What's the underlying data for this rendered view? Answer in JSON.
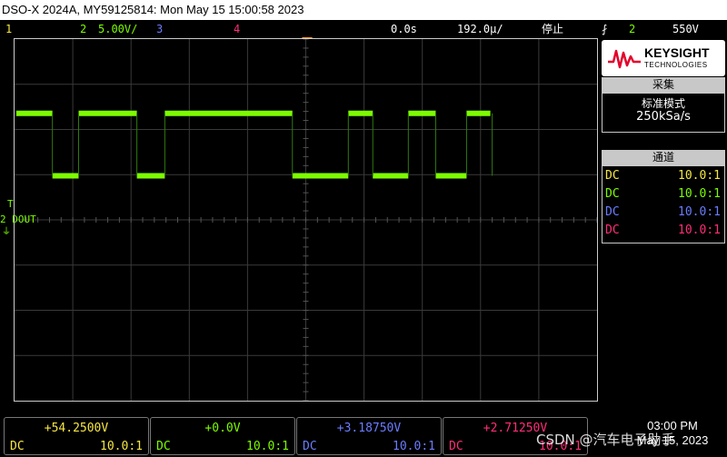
{
  "title": "DSO-X 2024A, MY59125814: Mon May 15 15:00:58 2023",
  "status": {
    "ch1_num": "1",
    "ch2_num": "2",
    "ch2_scale": "5.00V/",
    "ch3_num": "3",
    "ch4_num": "4",
    "time_offset": "0.0s",
    "time_scale": "192.0µ/",
    "run_state": "停止",
    "trigger_icon": "trigger-edge-icon",
    "trigger_ch": "2",
    "trigger_level": "550V"
  },
  "brand": {
    "name": "KEYSIGHT",
    "sub": "TECHNOLOGIES",
    "color": "#e4002b"
  },
  "acquisition": {
    "header": "采集",
    "mode": "标准模式",
    "rate": "250kSa/s"
  },
  "channels_panel": {
    "header": "通道",
    "rows": [
      {
        "coupling": "DC",
        "ratio": "10.0:1",
        "color": "#f5e642"
      },
      {
        "coupling": "DC",
        "ratio": "10.0:1",
        "color": "#7cfc00"
      },
      {
        "coupling": "DC",
        "ratio": "10.0:1",
        "color": "#6b7cff"
      },
      {
        "coupling": "DC",
        "ratio": "10.0:1",
        "color": "#ff2d78"
      }
    ]
  },
  "bottom": [
    {
      "offset": "+54.2500V",
      "coupling": "DC",
      "ratio": "10.0:1",
      "color": "#f5e642"
    },
    {
      "offset": "+0.0V",
      "coupling": "DC",
      "ratio": "10.0:1",
      "color": "#7cfc00"
    },
    {
      "offset": "+3.18750V",
      "coupling": "DC",
      "ratio": "10.0:1",
      "color": "#6b7cff"
    },
    {
      "offset": "+2.71250V",
      "coupling": "DC",
      "ratio": "10.0:1",
      "color": "#ff2d78"
    }
  ],
  "channel_label": {
    "trigger_mark": "T",
    "text": "2 DOUT"
  },
  "clock": {
    "time": "03:00 PM",
    "date": "May 15, 2023"
  },
  "watermark": "CSDN @汽车电子助手",
  "waveform": {
    "color": "#7cfc00",
    "levels": [
      "high",
      "low",
      "high",
      "low",
      "high",
      "low",
      "high",
      "low",
      "high",
      "low",
      "high"
    ],
    "transitions_div": [
      0.65,
      1.1,
      2.1,
      2.58,
      4.77,
      5.73,
      6.15,
      6.76,
      7.23,
      7.76,
      8.2
    ],
    "high_div": 1.0,
    "low_div": 2.0
  }
}
